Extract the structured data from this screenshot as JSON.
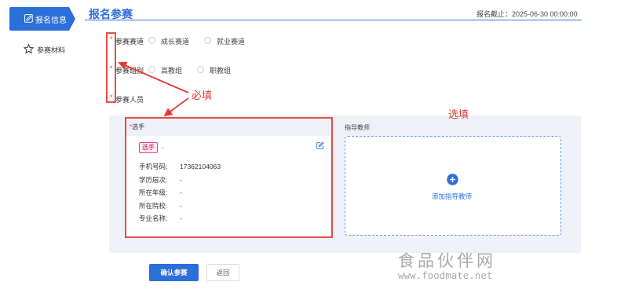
{
  "sidebar": {
    "items": [
      {
        "label": "报名信息",
        "icon": "edit-form-icon",
        "active": true
      },
      {
        "label": "参赛材料",
        "icon": "star-icon",
        "active": false
      }
    ]
  },
  "header": {
    "title": "报名参赛",
    "deadline": "报名截止：2025-06-30 00:00:00"
  },
  "form": {
    "track": {
      "label": "参赛赛道",
      "options": [
        "成长赛道",
        "就业赛道"
      ]
    },
    "group": {
      "label": "参赛组别",
      "options": [
        "高教组",
        "职教组"
      ]
    },
    "members": {
      "label": "参赛人员"
    },
    "required_mark": "*"
  },
  "player": {
    "heading": "选手",
    "tag": "选手",
    "name": "-",
    "fields": [
      {
        "key": "手机号码:",
        "value": "17362104063"
      },
      {
        "key": "学历层次:",
        "value": "-"
      },
      {
        "key": "所在年级:",
        "value": "-"
      },
      {
        "key": "所在院校:",
        "value": "-"
      },
      {
        "key": "专业名称:",
        "value": "-"
      }
    ]
  },
  "mentor": {
    "heading": "指导教师",
    "add_label": "添加指导教师"
  },
  "buttons": {
    "confirm": "确认参赛",
    "back": "返回"
  },
  "annotations": {
    "required": "必填",
    "optional": "选填"
  },
  "watermark": {
    "cn": "食品伙伴网",
    "url": "www.foodmate.net"
  },
  "colors": {
    "primary": "#2b6fd9",
    "annotation_red": "#e53935",
    "panel_bg": "#eef2f8"
  }
}
